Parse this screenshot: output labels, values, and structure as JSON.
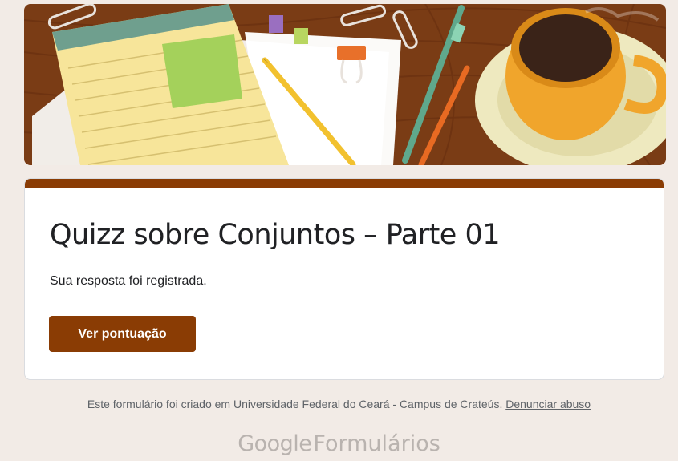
{
  "form": {
    "title": "Quizz sobre Conjuntos – Parte 01",
    "confirmation": "Sua resposta foi registrada.",
    "score_button": "Ver pontuação",
    "accent_color": "#8a3c04"
  },
  "footer": {
    "created_text": "Este formulário foi criado em Universidade Federal do Ceará - Campus de Crateús.",
    "report_link": "Denunciar abuso",
    "brand_google": "Google",
    "brand_forms": "Formulários"
  },
  "banner": {
    "icon": "desk-illustration"
  }
}
